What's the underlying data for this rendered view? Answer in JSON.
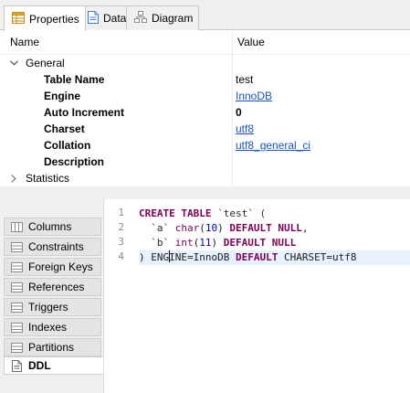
{
  "tabs": [
    {
      "label": "Properties",
      "icon": "properties-table-icon",
      "active": true
    },
    {
      "label": "Data",
      "icon": "data-sheet-icon",
      "active": false
    },
    {
      "label": "Diagram",
      "icon": "diagram-icon",
      "active": false
    }
  ],
  "properties": {
    "columns": {
      "name": "Name",
      "value": "Value"
    },
    "groups": {
      "general": "General",
      "statistics": "Statistics"
    },
    "rows": [
      {
        "key": "Table Name",
        "value": "test"
      },
      {
        "key": "Engine",
        "value": "InnoDB"
      },
      {
        "key": "Auto Increment",
        "value": "0"
      },
      {
        "key": "Charset",
        "value": "utf8"
      },
      {
        "key": "Collation",
        "value": "utf8_general_ci"
      },
      {
        "key": "Description",
        "value": ""
      }
    ]
  },
  "side_tabs": [
    {
      "label": "Columns",
      "active": false
    },
    {
      "label": "Constraints",
      "active": false
    },
    {
      "label": "Foreign Keys",
      "active": false
    },
    {
      "label": "References",
      "active": false
    },
    {
      "label": "Triggers",
      "active": false
    },
    {
      "label": "Indexes",
      "active": false
    },
    {
      "label": "Partitions",
      "active": false
    },
    {
      "label": "DDL",
      "active": true
    }
  ],
  "ddl": {
    "line_numbers": [
      "1",
      "2",
      "3",
      "4"
    ],
    "lines": [
      {
        "kw1": "CREATE TABLE",
        "id": " `test` ("
      },
      {
        "indent": "  ",
        "col": "`a`",
        "type": " char",
        "p1": "(",
        "num": "10",
        "p2": ") ",
        "kw": "DEFAULT NULL",
        "tail": ","
      },
      {
        "indent": "  ",
        "col": "`b`",
        "type": " int",
        "p1": "(",
        "num": "11",
        "p2": ") ",
        "kw": "DEFAULT NULL",
        "tail": ""
      },
      {
        "a": ") ",
        "b1": "ENG",
        "b2": "INE",
        "c": "=InnoDB ",
        "kw": "DEFAULT",
        "d": " CHARSET=utf8"
      }
    ]
  },
  "colors": {
    "keyword": "#7f0055",
    "number": "#0000c0",
    "link": "#1a55b8",
    "current_line": "#e8f2fe"
  }
}
